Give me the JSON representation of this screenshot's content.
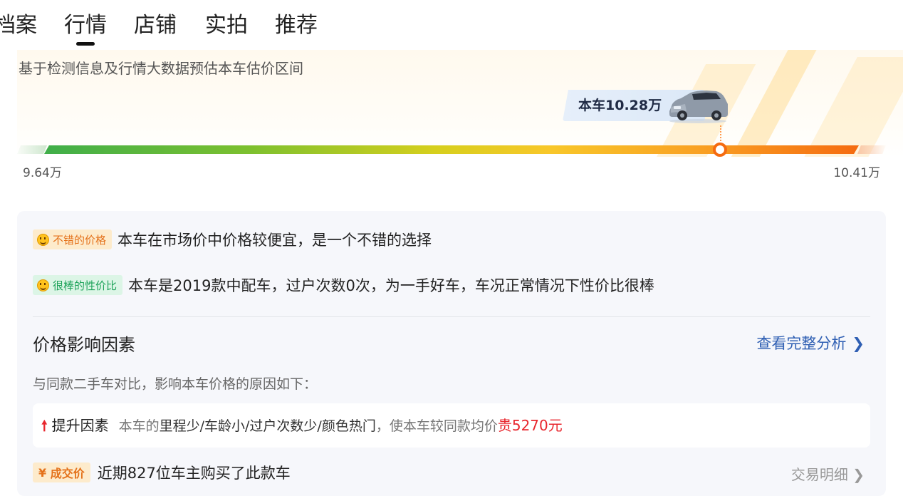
{
  "tabs": [
    {
      "label": "档案",
      "active": false
    },
    {
      "label": "行情",
      "active": true
    },
    {
      "label": "店铺",
      "active": false
    },
    {
      "label": "实拍",
      "active": false
    },
    {
      "label": "推荐",
      "active": false
    }
  ],
  "estimate": {
    "subtitle": "基于检测信息及行情大数据预估本车估价区间",
    "price_tag": "本车10.28万",
    "min_label": "9.64万",
    "max_label": "10.41万",
    "min_value": 9.64,
    "max_value": 10.41,
    "car_value": 10.28
  },
  "verdicts": [
    {
      "badge": "不错的价格",
      "badge_color": "#e4711a",
      "icon": "smile-emoji-icon",
      "text": "本车在市场价中价格较便宜，是一个不错的选择"
    },
    {
      "badge": "很棒的性价比",
      "badge_color": "#1ea35a",
      "icon": "grin-emoji-icon",
      "text": "本车是2019款中配车，过户次数0次，为一手好车，车况正常情况下性价比很棒"
    }
  ],
  "factors": {
    "title": "价格影响因素",
    "link": "查看完整分析",
    "description": "与同款二手车对比，影响本车价格的原因如下：",
    "up": {
      "icon": "arrow-up-icon",
      "name": "提升因素",
      "prefix": "本车的",
      "items": "里程少/车龄小/过户次数少/颜色热门",
      "middle": "，使本车较同款均价",
      "amount": "贵5270元"
    }
  },
  "deal": {
    "badge": "成交价",
    "text": "近期827位车主购买了此款车",
    "link": "交易明细"
  },
  "colors": {
    "accent_orange": "#f56b10",
    "link_blue": "#2f5fb3",
    "up_red": "#e8262d"
  }
}
